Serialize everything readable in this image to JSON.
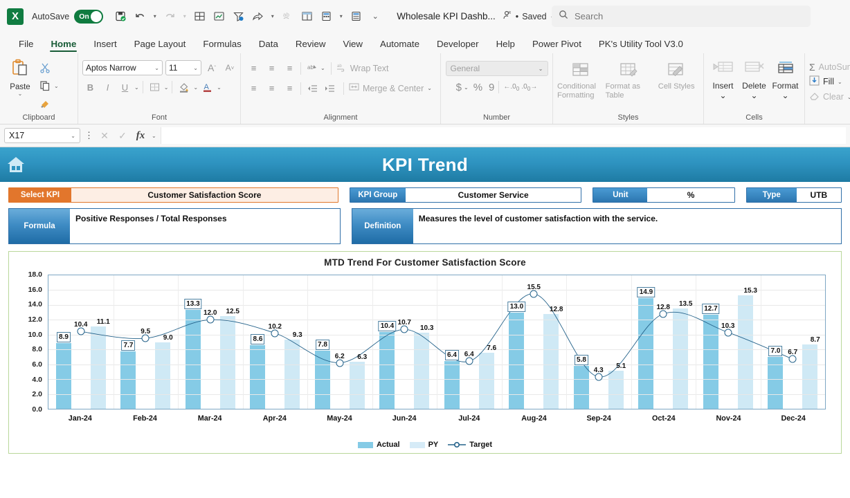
{
  "titlebar": {
    "logo": "X",
    "autosave_label": "AutoSave",
    "autosave_state": "On",
    "doc_title": "Wholesale KPI Dashb...",
    "saved_label": "Saved",
    "saved_sep": "•",
    "search_placeholder": "Search",
    "qat_icons": [
      "save-icon",
      "undo-icon",
      "redo-icon",
      "borders-icon",
      "chart-icon",
      "filter-icon",
      "share-icon",
      "spelling-icon",
      "pivot-icon",
      "calculate-icon",
      "calculate-sheet-icon",
      "customize-qat-icon"
    ]
  },
  "tabs": [
    {
      "label": "File",
      "active": false
    },
    {
      "label": "Home",
      "active": true
    },
    {
      "label": "Insert",
      "active": false
    },
    {
      "label": "Page Layout",
      "active": false
    },
    {
      "label": "Formulas",
      "active": false
    },
    {
      "label": "Data",
      "active": false
    },
    {
      "label": "Review",
      "active": false
    },
    {
      "label": "View",
      "active": false
    },
    {
      "label": "Automate",
      "active": false
    },
    {
      "label": "Developer",
      "active": false
    },
    {
      "label": "Help",
      "active": false
    },
    {
      "label": "Power Pivot",
      "active": false
    },
    {
      "label": "PK's Utility Tool V3.0",
      "active": false
    }
  ],
  "ribbon": {
    "clipboard": {
      "name": "Clipboard",
      "paste_label": "Paste",
      "cut_icon": "scissors-icon",
      "copy_icon": "copy-icon",
      "format_painter_icon": "format-painter-icon"
    },
    "font": {
      "name": "Font",
      "font_name": "Aptos Narrow",
      "font_size": "11",
      "grow_font": "A",
      "shrink_font": "A",
      "bold": "B",
      "italic": "I",
      "underline": "U",
      "borders_icon": "borders-icon",
      "fill_color_icon": "fill-color-icon",
      "font_color_icon": "font-color-icon"
    },
    "alignment": {
      "name": "Alignment",
      "wrap_text": "Wrap Text",
      "merge_center": "Merge & Center",
      "orientation_icon": "orientation-icon",
      "decrease_indent_icon": "decrease-indent-icon",
      "increase_indent_icon": "increase-indent-icon"
    },
    "number": {
      "name": "Number",
      "format": "General",
      "currency": "$",
      "percent": "%",
      "comma": "9",
      "increase_decimal": ".00",
      "decrease_decimal": ".0"
    },
    "styles": {
      "name": "Styles",
      "conditional_formatting": "Conditional Formatting",
      "format_as_table": "Format as Table",
      "cell_styles": "Cell Styles"
    },
    "cells": {
      "name": "Cells",
      "insert": "Insert",
      "delete": "Delete",
      "format": "Format"
    },
    "editing": {
      "autosum": "AutoSum",
      "fill": "Fill",
      "clear": "Clear"
    }
  },
  "formula_bar": {
    "name_box": "X17",
    "cancel_icon": "cancel-icon",
    "confirm_icon": "confirm-icon",
    "fx_icon": "fx-icon",
    "value": ""
  },
  "dashboard": {
    "home_icon": "home-icon",
    "banner_title": "KPI Trend",
    "fields": [
      {
        "key": "select_kpi",
        "label": "Select KPI",
        "value": "Customer Satisfaction Score"
      },
      {
        "key": "kpi_group",
        "label": "KPI Group",
        "value": "Customer Service"
      },
      {
        "key": "unit",
        "label": "Unit",
        "value": "%"
      },
      {
        "key": "type",
        "label": "Type",
        "value": "UTB"
      }
    ],
    "formula": {
      "label": "Formula",
      "value": "Positive Responses / Total Responses"
    },
    "definition": {
      "label": "Definition",
      "value": "Measures the level of customer satisfaction with the service."
    },
    "colors": {
      "banner_start": "#3aa3cd",
      "banner_end": "#1e7ba3",
      "orange": "#e2762c",
      "orange_bg": "#fdeee4",
      "blue": "#2f6fa8",
      "actual": "#85cbe6",
      "py": "#cfe9f5",
      "target": "#24628a"
    }
  },
  "chart_data": {
    "type": "bar",
    "title": "MTD Trend For Customer Satisfaction Score",
    "xlabel": "",
    "ylabel": "",
    "ylim": [
      0,
      18
    ],
    "ytick_step": 2,
    "yticks": [
      "0.0",
      "2.0",
      "4.0",
      "6.0",
      "8.0",
      "10.0",
      "12.0",
      "14.0",
      "16.0",
      "18.0"
    ],
    "grid": true,
    "legend_position": "bottom",
    "categories": [
      "Jan-24",
      "Feb-24",
      "Mar-24",
      "Apr-24",
      "May-24",
      "Jun-24",
      "Jul-24",
      "Aug-24",
      "Sep-24",
      "Oct-24",
      "Nov-24",
      "Dec-24"
    ],
    "series": [
      {
        "name": "Actual",
        "kind": "bar",
        "color": "#85cbe6",
        "values": [
          8.9,
          7.7,
          13.3,
          8.6,
          7.8,
          10.4,
          6.4,
          13.0,
          5.8,
          14.9,
          12.7,
          7.0
        ]
      },
      {
        "name": "PY",
        "kind": "bar",
        "color": "#cfe9f5",
        "values": [
          11.1,
          9.0,
          12.5,
          9.3,
          6.3,
          10.3,
          7.6,
          12.8,
          5.1,
          13.5,
          15.3,
          8.7
        ]
      },
      {
        "name": "Target",
        "kind": "line",
        "color": "#24628a",
        "values": [
          10.4,
          9.5,
          12.0,
          10.2,
          6.2,
          10.7,
          6.4,
          15.5,
          4.3,
          12.8,
          10.3,
          6.7
        ]
      }
    ]
  }
}
